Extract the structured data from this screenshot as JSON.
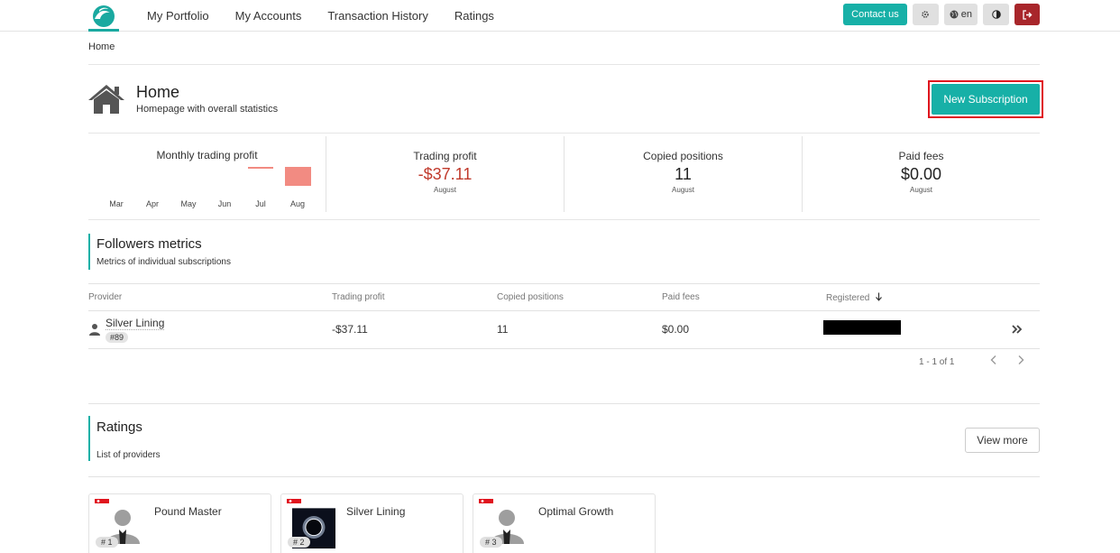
{
  "nav": {
    "links": [
      "My Portfolio",
      "My Accounts",
      "Transaction History",
      "Ratings"
    ],
    "contact_label": "Contact us",
    "lang_label": "en"
  },
  "breadcrumb": "Home",
  "page": {
    "title": "Home",
    "subtitle": "Homepage with overall statistics",
    "new_subscription_label": "New Subscription"
  },
  "stats": {
    "chart": {
      "title": "Monthly trading profit",
      "months": [
        "Mar",
        "Apr",
        "May",
        "Jun",
        "Jul",
        "Aug"
      ],
      "bar_color": "#f28b82"
    },
    "trading_profit": {
      "label": "Trading profit",
      "value": "-$37.11",
      "period": "August"
    },
    "copied_positions": {
      "label": "Copied positions",
      "value": "11",
      "period": "August"
    },
    "paid_fees": {
      "label": "Paid fees",
      "value": "$0.00",
      "period": "August"
    }
  },
  "followers": {
    "title": "Followers metrics",
    "subtitle": "Metrics of individual subscriptions",
    "columns": [
      "Provider",
      "Trading profit",
      "Copied positions",
      "Paid fees",
      "Registered"
    ],
    "rows": [
      {
        "provider": "Silver Lining",
        "badge": "#89",
        "trading_profit": "-$37.11",
        "copied_positions": "11",
        "paid_fees": "$0.00"
      }
    ],
    "pagination": "1 - 1 of 1"
  },
  "ratings": {
    "title": "Ratings",
    "subtitle": "List of providers",
    "view_more_label": "View more",
    "cards": [
      {
        "name": "Pound Master",
        "rank": "# 1"
      },
      {
        "name": "Silver Lining",
        "rank": "# 2"
      },
      {
        "name": "Optimal Growth",
        "rank": "# 3"
      }
    ]
  },
  "colors": {
    "accent": "#17b0a7",
    "danger": "#a8262b",
    "negative": "#c0392b",
    "highlight_border": "#e0141e"
  }
}
